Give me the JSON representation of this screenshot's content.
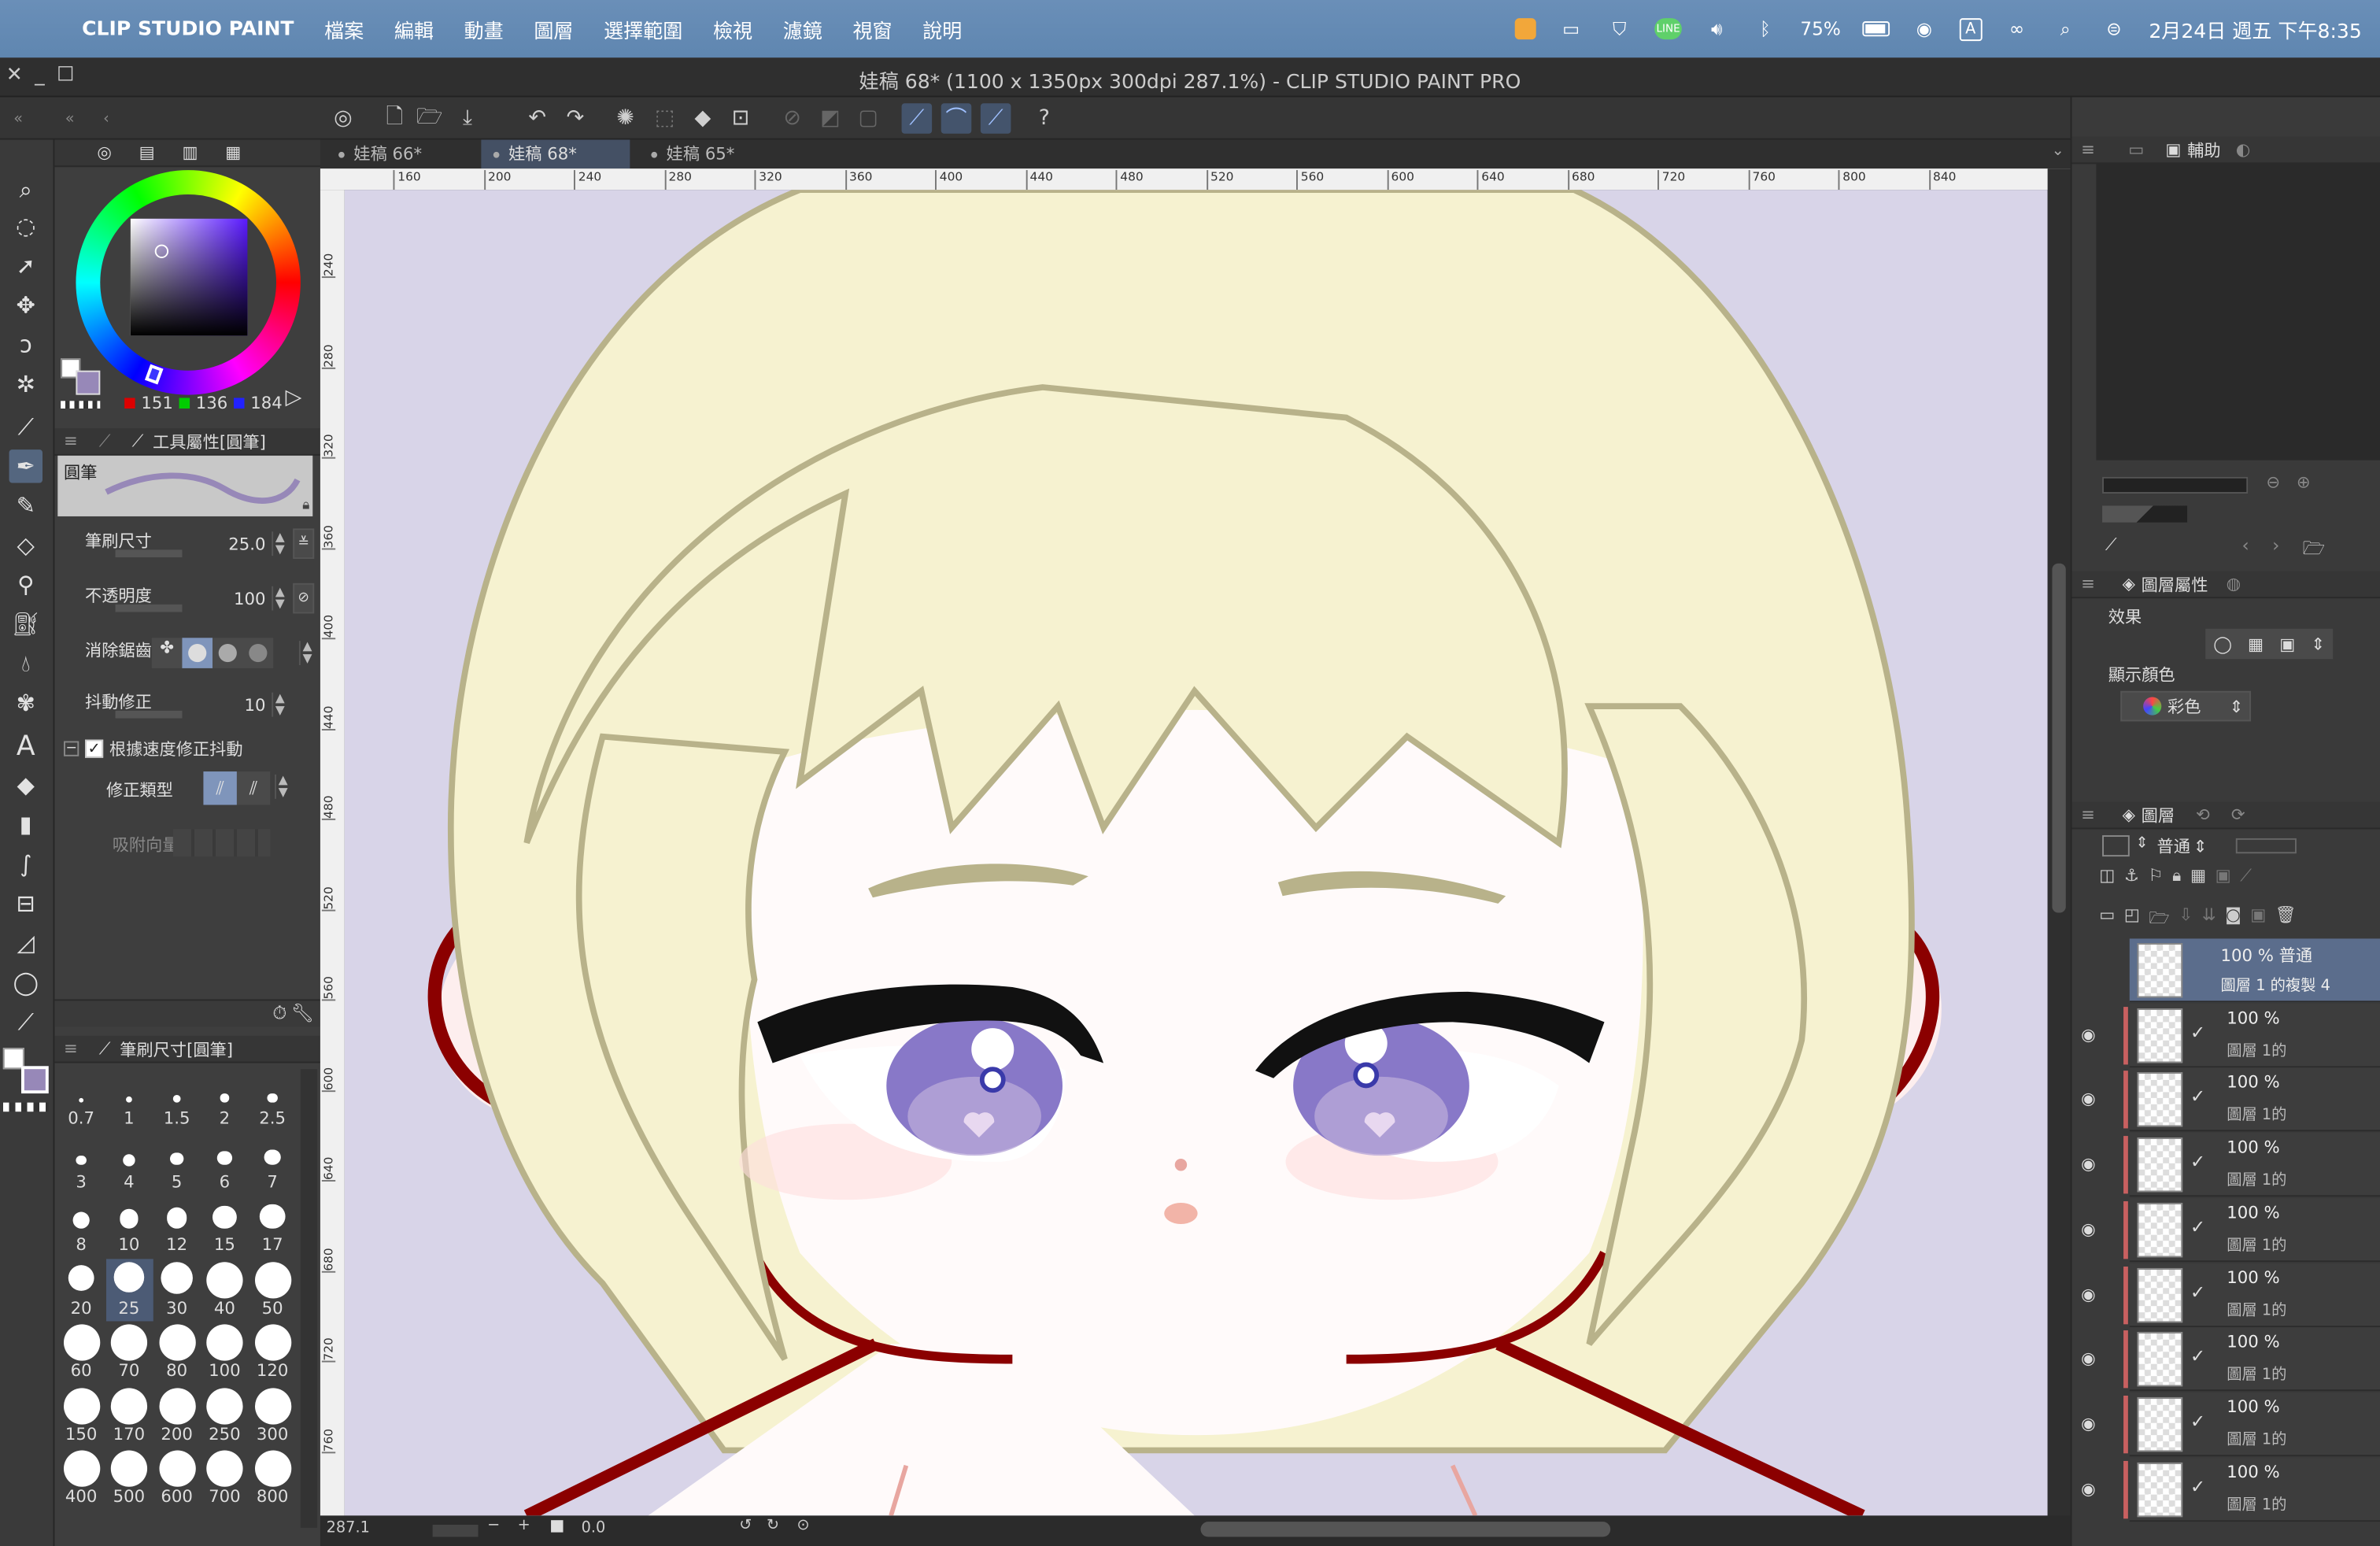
{
  "menubar": {
    "app_name": "CLIP STUDIO PAINT",
    "items": [
      "檔案",
      "編輯",
      "動畫",
      "圖層",
      "選擇範圍",
      "檢視",
      "濾鏡",
      "視窗",
      "說明"
    ],
    "battery": "75%",
    "ime": "A",
    "datetime": "2月24日 週五 下午8:35"
  },
  "window": {
    "title": "娃稿 68* (1100 x 1350px 300dpi 287.1%)  - CLIP STUDIO PAINT PRO"
  },
  "canvas_tabs": [
    {
      "label": "娃稿 66*"
    },
    {
      "label": "娃稿 68*"
    },
    {
      "label": "娃稿 65*"
    }
  ],
  "ruler_h": [
    "160",
    "200",
    "240",
    "280",
    "320",
    "360",
    "400",
    "440",
    "480",
    "520",
    "560",
    "600",
    "640",
    "680",
    "720",
    "760",
    "800",
    "840"
  ],
  "ruler_v": [
    "240",
    "280",
    "320",
    "360",
    "400",
    "440",
    "480",
    "520",
    "560",
    "600",
    "640",
    "680",
    "720",
    "760"
  ],
  "color": {
    "r": "151",
    "g": "136",
    "b": "184",
    "current": "#9788b8",
    "hue": "#5a1aff"
  },
  "tool_property": {
    "header": "工具屬性[圓筆]",
    "preset": "圓筆",
    "brush_size_label": "筆刷尺寸",
    "brush_size": "25.0",
    "opacity_label": "不透明度",
    "opacity": "100",
    "antialias_label": "消除鋸齒",
    "stabilization_label": "抖動修正",
    "stabilization": "10",
    "speed_check_label": "根據速度修正抖動",
    "correction_type_label": "修正類型",
    "snap_label": "吸附向量"
  },
  "brush_size_panel": {
    "header": "筆刷尺寸[圓筆]",
    "sizes": [
      "0.7",
      "1",
      "1.5",
      "2",
      "2.5",
      "3",
      "4",
      "5",
      "6",
      "7",
      "8",
      "10",
      "12",
      "15",
      "17",
      "20",
      "25",
      "30",
      "40",
      "50",
      "60",
      "70",
      "80",
      "100",
      "120",
      "150",
      "170",
      "200",
      "250",
      "300",
      "400",
      "500",
      "600",
      "700",
      "800"
    ],
    "selected": "25"
  },
  "status": {
    "zoom": "287.1",
    "angle": "0.0"
  },
  "right_panel": {
    "aux_tab": "輔助",
    "layer_property_tab": "圖層屬性",
    "effect_label": "效果",
    "display_color_label": "顯示顏色",
    "display_color_value": "彩色",
    "layer_tab": "圖層",
    "blend_mode": "普通",
    "layers": [
      {
        "pct": "100 % 普通",
        "name": "圖層 1 的複製 4",
        "selected": true
      },
      {
        "pct": "100 %",
        "name": "圖層 1的"
      },
      {
        "pct": "100 %",
        "name": "圖層 1的"
      },
      {
        "pct": "100 %",
        "name": "圖層 1的"
      },
      {
        "pct": "100 %",
        "name": "圖層 1的"
      },
      {
        "pct": "100 %",
        "name": "圖層 1的"
      },
      {
        "pct": "100 %",
        "name": "圖層 1的"
      },
      {
        "pct": "100 %",
        "name": "圖層 1的"
      },
      {
        "pct": "100 %",
        "name": "圖層 1的"
      }
    ]
  }
}
